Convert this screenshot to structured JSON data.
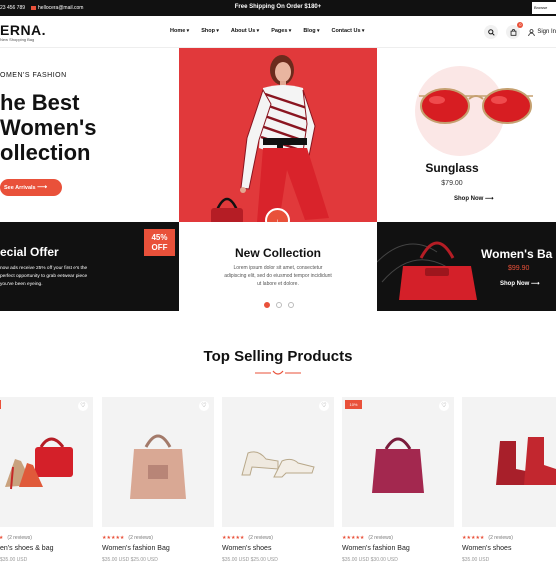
{
  "topbar": {
    "phone": "23 456 789",
    "email": "hellocera@mail.com",
    "shipping": "Free Shipping On Order $180+",
    "browse": "Browse"
  },
  "header": {
    "logo": "ERNA.",
    "logo_sub": "New Shopping Bag",
    "nav": [
      "Home",
      "Shop",
      "About Us",
      "Pages",
      "Blog",
      "Contact Us"
    ],
    "cart_count": "0",
    "signin": "Sign In"
  },
  "hero": {
    "kicker": "OMEN'S FASHION",
    "title_line1": "he Best",
    "title_line2": "Women's",
    "title_line3": "ollection",
    "cta": "See Arrivals",
    "right": {
      "title": "Sunglass",
      "price": "$79.00",
      "cta": "Shop Now"
    }
  },
  "promo": {
    "special": {
      "title": "ecial Offer",
      "text": "now ads receive 25% off your first e's the perfect opportunity to grab eetwear piece you've been eyeing.",
      "badge_pct": "45%",
      "badge_off": "OFF"
    },
    "new_collection": {
      "title": "New Collection",
      "text": "Lorem ipsum dolor sit amet, consectetur adipiscing elit, sed do eiusmod tempor incididunt ut labore et dolore."
    },
    "womens_bag": {
      "title": "Women's Ba",
      "price": "$99.90",
      "cta": "Shop Now"
    }
  },
  "products": {
    "title": "Top Selling Products",
    "items": [
      {
        "name": "en's shoes & bag",
        "reviews": "(2 reviews)",
        "price": "$35.00 USD",
        "sale": "%"
      },
      {
        "name": "Women's fashion Bag",
        "reviews": "(2 reviews)",
        "price": "$35.00 USD $25.00 USD",
        "sale": ""
      },
      {
        "name": "Women's shoes",
        "reviews": "(2 reviews)",
        "price": "$35.00 USD $25.00 USD",
        "sale": ""
      },
      {
        "name": "Women's fashion Bag",
        "reviews": "(2 reviews)",
        "price": "$35.00 USD $30.00 USD",
        "sale": "10%"
      },
      {
        "name": "Women's shoes",
        "reviews": "(2 reviews)",
        "price": "$35.00 USD",
        "sale": ""
      }
    ]
  },
  "colors": {
    "accent": "#e9513a",
    "dark": "#111111"
  }
}
